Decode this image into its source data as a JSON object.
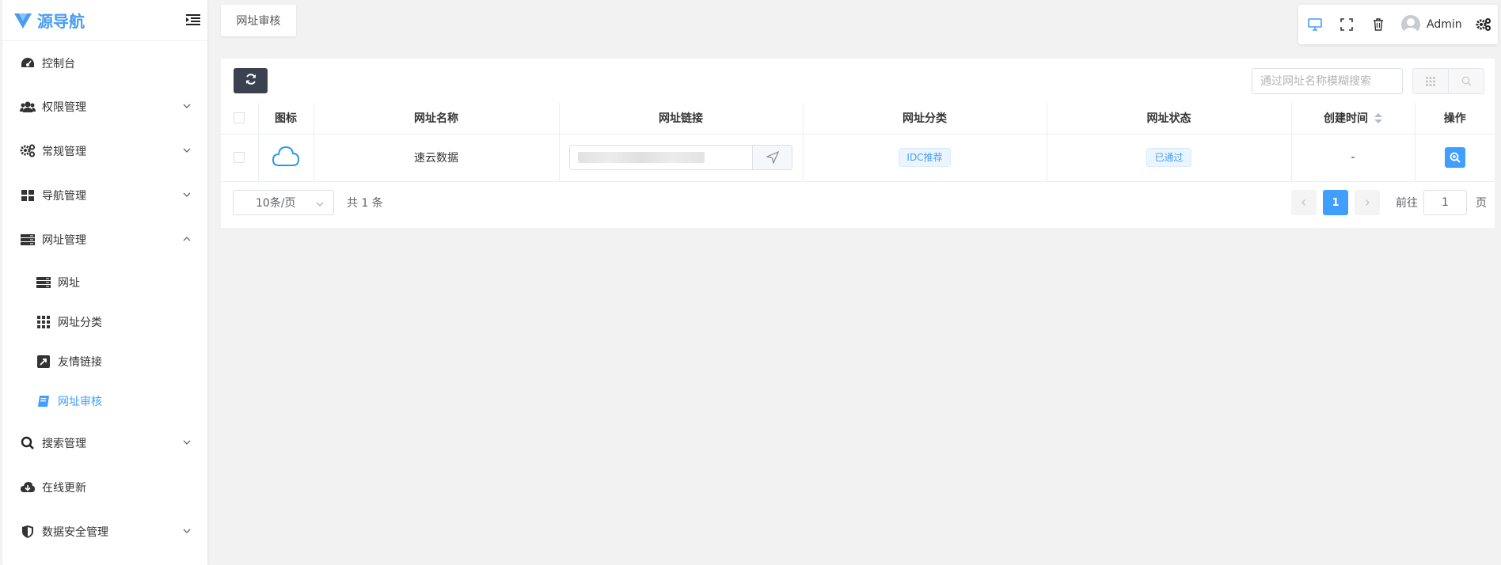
{
  "brand": {
    "name": "源导航"
  },
  "sidebar": {
    "items": [
      {
        "label": "控制台",
        "icon": "dashboard-icon"
      },
      {
        "label": "权限管理",
        "icon": "users-icon"
      },
      {
        "label": "常规管理",
        "icon": "cogs-icon"
      },
      {
        "label": "导航管理",
        "icon": "grid-icon"
      },
      {
        "label": "网址管理",
        "icon": "server-icon"
      },
      {
        "label": "搜索管理",
        "icon": "search-icon"
      },
      {
        "label": "在线更新",
        "icon": "cloud-download-icon"
      },
      {
        "label": "数据安全管理",
        "icon": "shield-icon"
      }
    ],
    "sub_items": [
      {
        "label": "网址",
        "icon": "server-icon"
      },
      {
        "label": "网址分类",
        "icon": "grid-dots-icon"
      },
      {
        "label": "友情链接",
        "icon": "external-link-icon"
      },
      {
        "label": "网址审核",
        "icon": "book-icon",
        "active": true
      }
    ]
  },
  "tabs": {
    "current": "网址审核"
  },
  "toolbar": {
    "user_name": "Admin"
  },
  "search": {
    "placeholder": "通过网址名称模糊搜索"
  },
  "table": {
    "headers": [
      "图标",
      "网址名称",
      "网址链接",
      "网址分类",
      "网址状态",
      "创建时间",
      "操作"
    ],
    "rows": [
      {
        "icon": "cloud-icon",
        "name": "速云数据",
        "category": "IDC推荐",
        "status": "已通过",
        "created": "-"
      }
    ]
  },
  "pagination": {
    "page_size": "10条/页",
    "total": "共 1 条",
    "current_page": "1",
    "goto_prefix": "前往",
    "goto_value": "1",
    "goto_suffix": "页"
  },
  "colors": {
    "accent": "#409eff",
    "brand": "#4a9cf0",
    "dark_button": "#3a4250"
  }
}
